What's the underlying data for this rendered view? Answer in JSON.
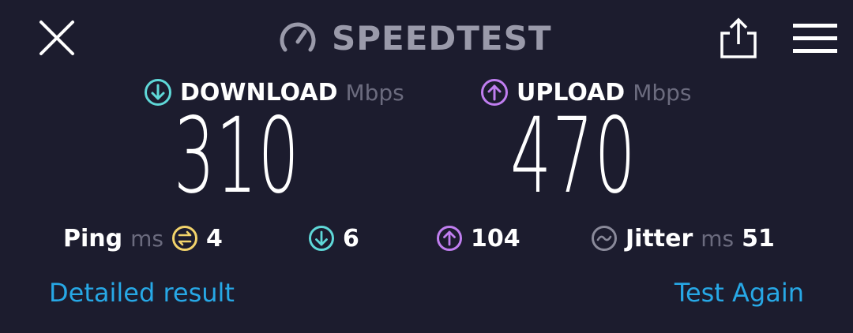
{
  "header": {
    "title": "SPEEDTEST",
    "close_icon": "close-icon",
    "logo_icon": "speedometer-icon",
    "share_icon": "share-icon",
    "menu_icon": "hamburger-menu-icon"
  },
  "download": {
    "label": "DOWNLOAD",
    "unit": "Mbps",
    "value": "310",
    "icon": "arrow-down-circle-icon",
    "color": "#5fd8d8"
  },
  "upload": {
    "label": "UPLOAD",
    "unit": "Mbps",
    "value": "470",
    "icon": "arrow-up-circle-icon",
    "color": "#c07ef0"
  },
  "stats": {
    "ping_label": "Ping",
    "ping_unit": "ms",
    "ping_value": "4",
    "ping_icon_color": "#f2d36b",
    "download_latency": "6",
    "upload_latency": "104",
    "jitter_label": "Jitter",
    "jitter_unit": "ms",
    "jitter_value": "51",
    "jitter_icon_color": "#8a8a9a"
  },
  "links": {
    "detailed": "Detailed result",
    "again": "Test Again",
    "color": "#27a8e6"
  }
}
